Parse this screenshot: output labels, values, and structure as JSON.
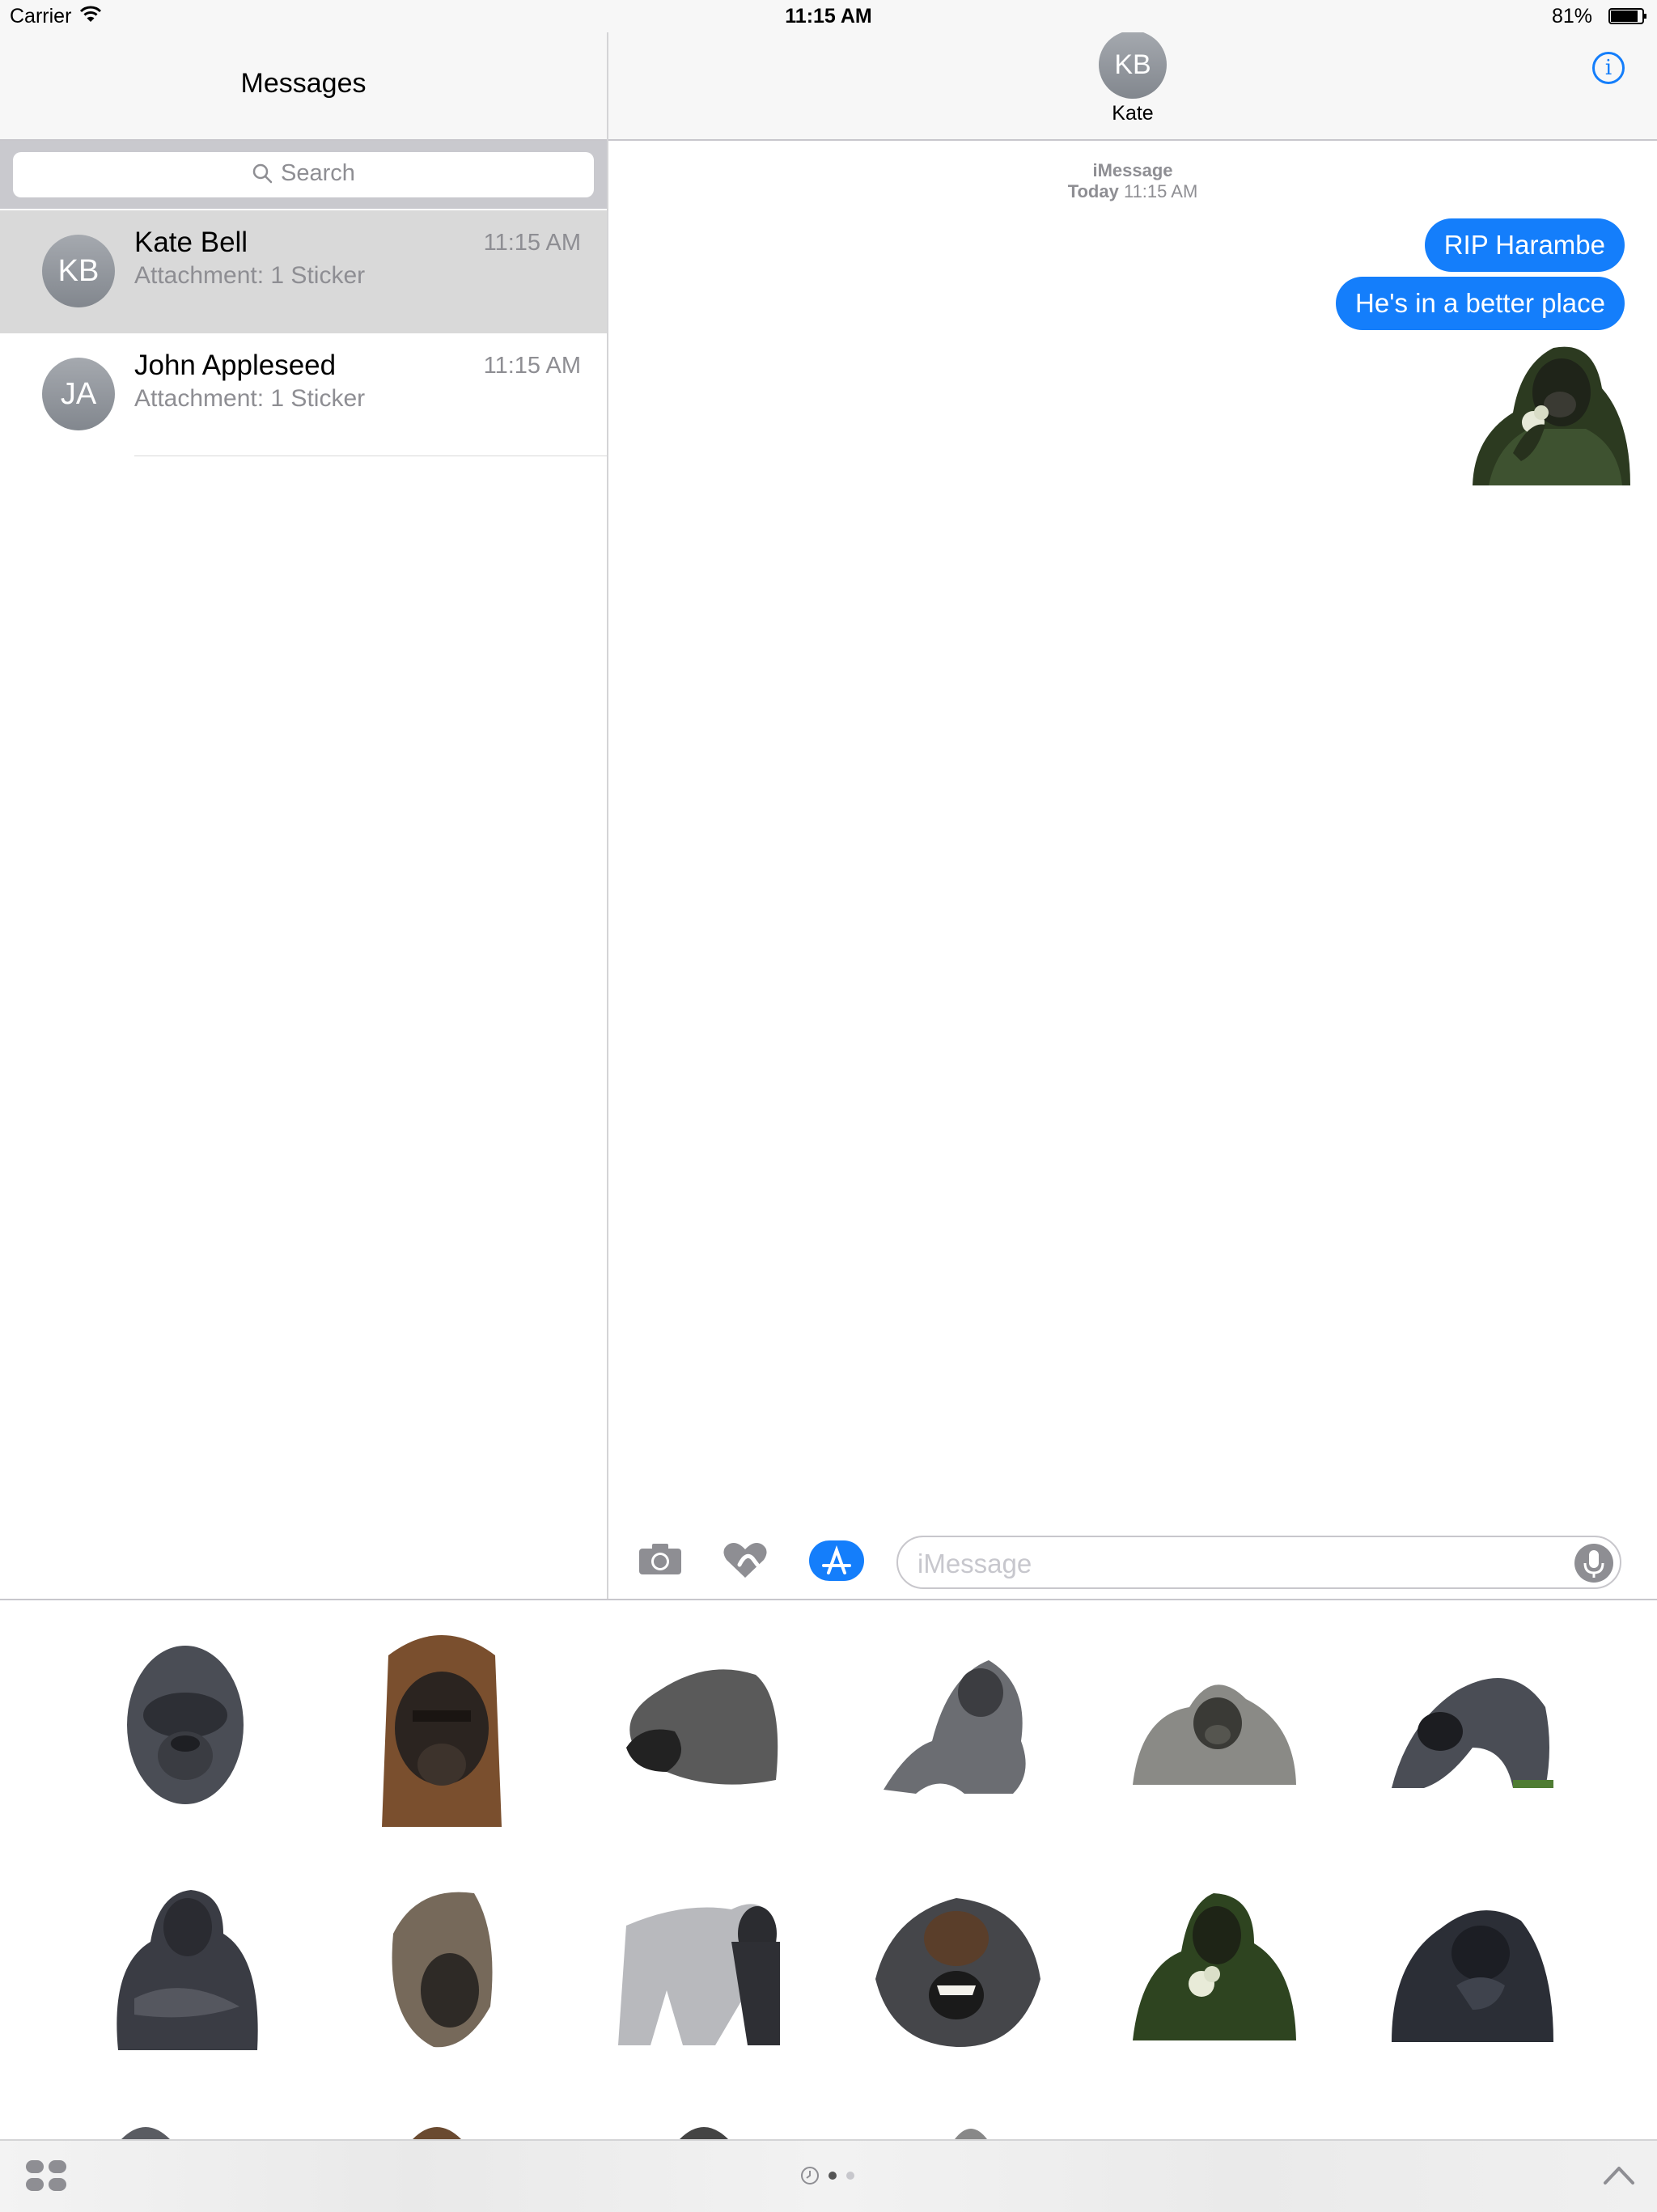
{
  "status_bar": {
    "carrier": "Carrier",
    "time": "11:15 AM",
    "battery": "81%",
    "wifi_icon": "wifi-icon",
    "battery_icon": "battery-icon"
  },
  "sidebar": {
    "title": "Messages",
    "search_placeholder": "Search",
    "conversations": [
      {
        "initials": "KB",
        "name": "Kate Bell",
        "preview": "Attachment: 1 Sticker",
        "time": "11:15 AM",
        "selected": true
      },
      {
        "initials": "JA",
        "name": "John Appleseed",
        "preview": "Attachment: 1 Sticker",
        "time": "11:15 AM",
        "selected": false
      }
    ]
  },
  "chat": {
    "contact_initials": "KB",
    "contact_name": "Kate",
    "info_icon": "info-icon",
    "service": "iMessage",
    "date_day": "Today",
    "date_time": "11:15 AM",
    "messages": [
      {
        "text": "RIP Harambe"
      },
      {
        "text": "He's in a better place"
      },
      {
        "sticker": "gorilla-holding-flower-sticker"
      }
    ]
  },
  "input": {
    "placeholder": "iMessage",
    "icons": [
      "camera-icon",
      "digital-touch-icon",
      "app-store-icon",
      "microphone-icon"
    ]
  },
  "sticker_drawer": {
    "stickers": [
      "gorilla-face-front-sticker",
      "gorilla-face-brown-sticker",
      "gorilla-profile-head-sticker",
      "gorilla-crouching-sticker",
      "gorilla-sitting-sticker",
      "gorilla-knuckle-walk-sticker",
      "gorilla-seated-arms-crossed-sticker",
      "gorilla-head-tilted-sticker",
      "silverback-side-sticker",
      "gorilla-open-mouth-sticker",
      "gorilla-holding-flower-sticker",
      "gorilla-hand-to-mouth-sticker"
    ],
    "page_count": 2,
    "active_page": 1
  },
  "colors": {
    "accent": "#147efb",
    "selected_row": "#d9d9d9",
    "secondary_text": "#8e8e93"
  }
}
